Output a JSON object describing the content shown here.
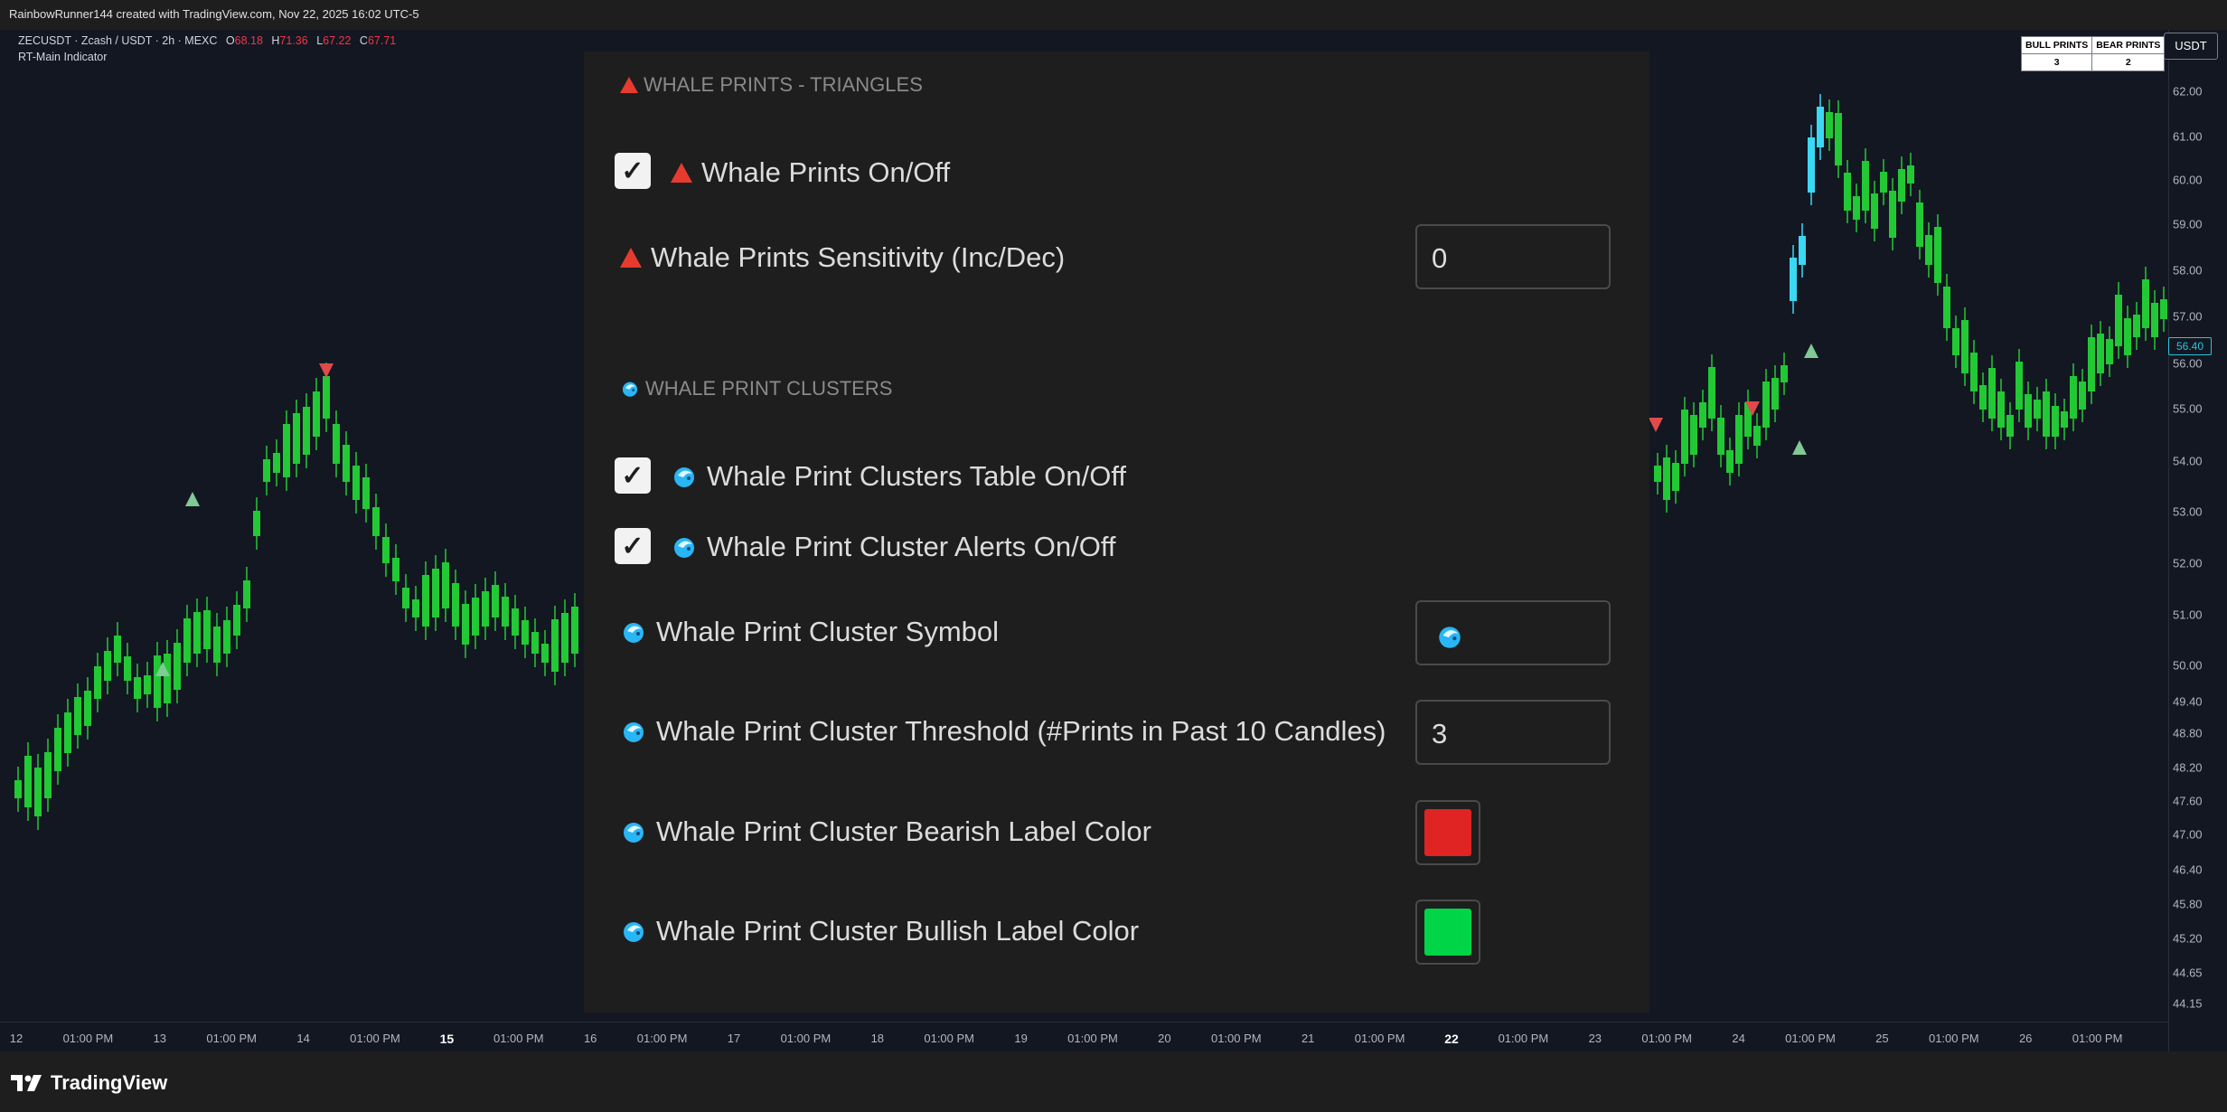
{
  "header": {
    "attribution": "RainbowRunner144 created with TradingView.com, Nov 22, 2025 16:02 UTC-5"
  },
  "symbol": {
    "description": "ZECUSDT · Zcash / USDT · 2h · MEXC",
    "open_label": "O",
    "open": "68.18",
    "high_label": "H",
    "high": "71.36",
    "low_label": "L",
    "low": "67.22",
    "close_label": "C",
    "close": "67.71",
    "indicator": "RT-Main Indicator"
  },
  "currency_button": "USDT",
  "prints_table": {
    "headers": [
      "BULL PRINTS",
      "BEAR PRINTS"
    ],
    "values": [
      "3",
      "2"
    ]
  },
  "price_axis": {
    "ticks": [
      "62.00",
      "61.00",
      "60.00",
      "59.00",
      "58.00",
      "57.00",
      "56.00",
      "55.00",
      "54.00",
      "53.00",
      "52.00",
      "51.00",
      "50.00",
      "49.40",
      "48.80",
      "48.20",
      "47.60",
      "47.00",
      "46.40",
      "45.80",
      "45.20",
      "44.65",
      "44.15"
    ],
    "current_price": "56.40"
  },
  "time_axis": {
    "ticks": [
      "12",
      "01:00 PM",
      "13",
      "01:00 PM",
      "14",
      "01:00 PM",
      "15",
      "01:00 PM",
      "16",
      "01:00 PM",
      "17",
      "01:00 PM",
      "18",
      "01:00 PM",
      "19",
      "01:00 PM",
      "20",
      "01:00 PM",
      "21",
      "01:00 PM",
      "22",
      "01:00 PM",
      "23",
      "01:00 PM",
      "24",
      "01:00 PM",
      "25",
      "01:00 PM",
      "26",
      "01:00 PM"
    ]
  },
  "settings": {
    "section1_title": "WHALE PRINTS - TRIANGLES",
    "whale_prints_toggle": {
      "label": "Whale Prints On/Off",
      "checked": true
    },
    "sensitivity": {
      "label": "Whale Prints Sensitivity (Inc/Dec)",
      "value": "0"
    },
    "section2_title": "WHALE PRINT CLUSTERS",
    "clusters_table_toggle": {
      "label": "Whale Print Clusters Table On/Off",
      "checked": true
    },
    "cluster_alerts_toggle": {
      "label": "Whale Print Cluster Alerts On/Off",
      "checked": true
    },
    "cluster_symbol": {
      "label": "Whale Print Cluster Symbol",
      "value_icon": "whale-icon"
    },
    "cluster_threshold": {
      "label": "Whale Print Cluster Threshold (#Prints in Past 10 Candles)",
      "value": "3"
    },
    "bearish_color": {
      "label": "Whale Print Cluster Bearish Label Color",
      "color": "#e02424"
    },
    "bullish_color": {
      "label": "Whale Print Cluster Bullish Label Color",
      "color": "#00d447"
    }
  },
  "footer": {
    "brand": "TradingView"
  },
  "colors": {
    "candle_up": "#22c935",
    "candle_down": "#22c935",
    "cyan_candle": "#3ad8f2",
    "bull_triangle": "#81c995",
    "bear_triangle": "#e04a4a"
  }
}
